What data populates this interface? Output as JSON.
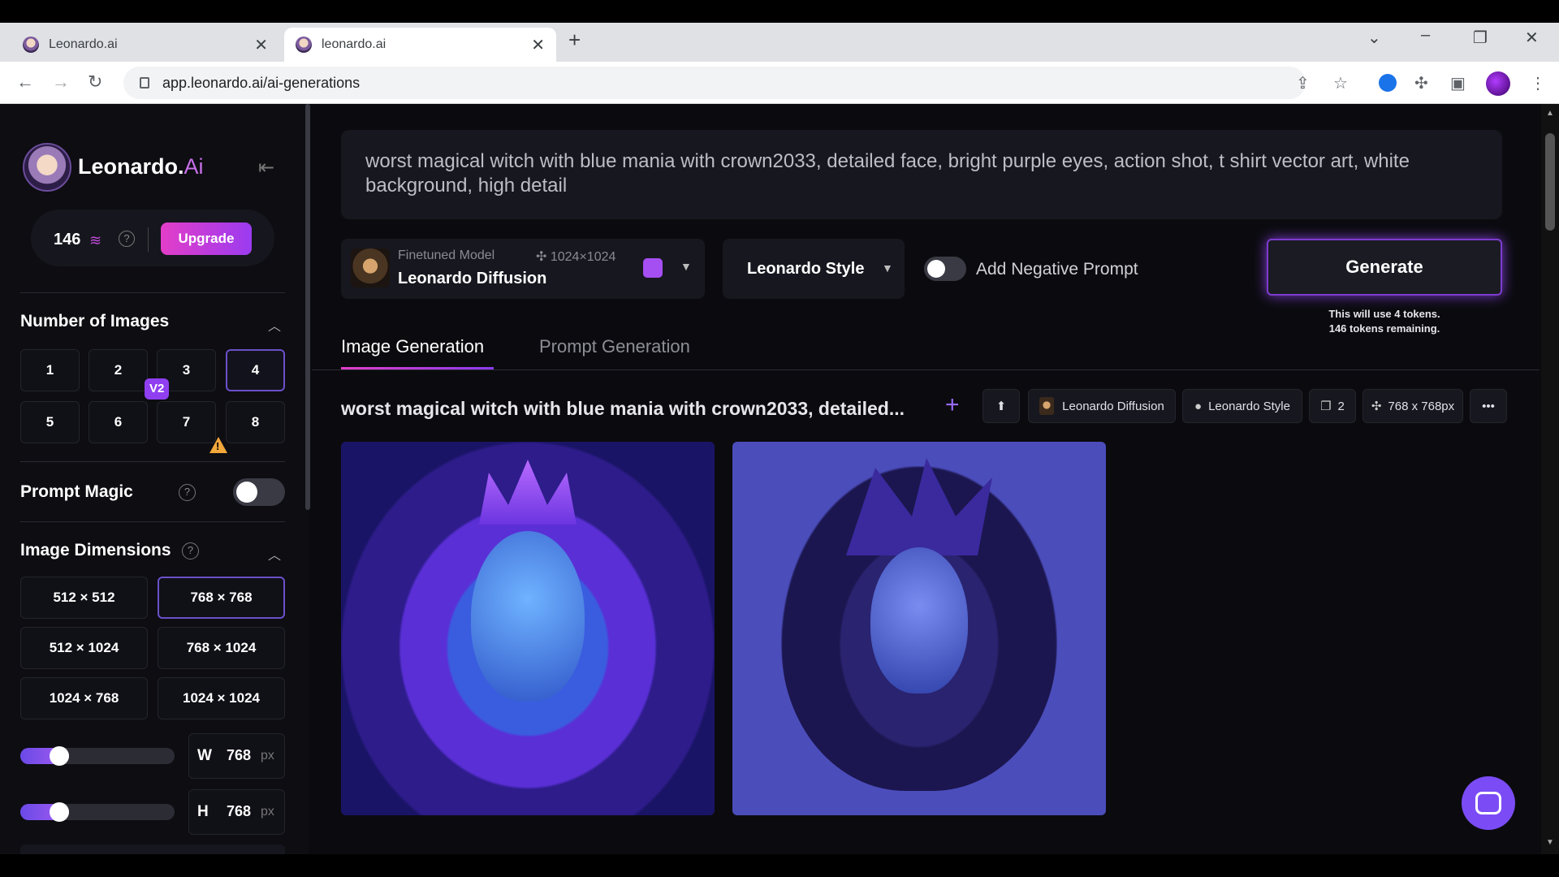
{
  "browser": {
    "tabs": [
      {
        "title": "Leonardo.ai"
      },
      {
        "title": "leonardo.ai"
      }
    ],
    "url": "app.leonardo.ai/ai-generations"
  },
  "sidebar": {
    "brand_name": "Leonardo.",
    "brand_suffix": "Ai",
    "tokens": "146",
    "upgrade_label": "Upgrade",
    "num_images": {
      "title": "Number of Images",
      "options": [
        "1",
        "2",
        "3",
        "4",
        "5",
        "6",
        "7",
        "8"
      ],
      "selected": "4"
    },
    "prompt_magic": {
      "title": "Prompt Magic",
      "badge": "V2",
      "enabled": false
    },
    "dimensions": {
      "title": "Image Dimensions",
      "options": [
        "512 × 512",
        "768 × 768",
        "512 × 1024",
        "768 × 1024",
        "1024 × 768",
        "1024 × 1024"
      ],
      "selected": "768 × 768",
      "width": {
        "label": "W",
        "value": "768",
        "unit": "px"
      },
      "height": {
        "label": "H",
        "value": "768",
        "unit": "px"
      }
    }
  },
  "main": {
    "prompt": "worst magical witch with blue mania with crown2033, detailed face, bright purple eyes, action shot, t shirt vector art, white background, high detail",
    "model": {
      "label": "Finetuned Model",
      "resolution": "1024×1024",
      "name": "Leonardo Diffusion"
    },
    "style": "Leonardo Style",
    "negative_prompt_label": "Add Negative Prompt",
    "generate_label": "Generate",
    "token_note_1": "This will use 4 tokens.",
    "token_note_2": "146 tokens remaining.",
    "tabs": [
      "Image Generation",
      "Prompt Generation"
    ],
    "generation": {
      "title": "worst magical witch with blue mania with crown2033, detailed...",
      "chips": {
        "model": "Leonardo Diffusion",
        "style": "Leonardo Style",
        "count": "2",
        "size": "768 x 768px"
      }
    }
  },
  "colors": {
    "accent_pink": "#e33ec8",
    "accent_purple": "#8a3cf0",
    "background": "#0b0b0f"
  }
}
